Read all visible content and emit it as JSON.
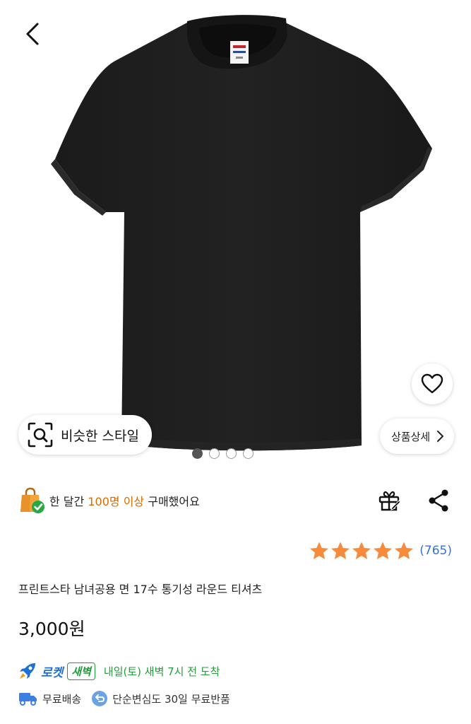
{
  "nav": {
    "back_icon": "chevron-left-icon"
  },
  "gallery": {
    "similar_style_label": "비슷한 스타일",
    "detail_label": "상품상세",
    "image_count": 4,
    "active_index": 0
  },
  "purchase": {
    "prefix": "한 달간 ",
    "highlight": "100명 이상",
    "suffix": " 구매했어요"
  },
  "rating": {
    "stars": 5,
    "review_count": "(765)"
  },
  "product": {
    "title": "프린트스타 남녀공용 면 17수 통기성 라운드 티셔츠",
    "price": "3,000원"
  },
  "delivery": {
    "rocket_label": "로켓",
    "dawn_label": "새벽",
    "arrival": "내일(토) 새벽 7시 전 도착",
    "free_shipping": "무료배송",
    "free_return": "단순변심도 30일 무료반품"
  },
  "colors": {
    "highlight": "#d86b00",
    "star": "#f68b3c",
    "review_link": "#3a6fd8",
    "rocket_blue": "#1f6fd6",
    "dawn_green": "#1f9d3a"
  }
}
